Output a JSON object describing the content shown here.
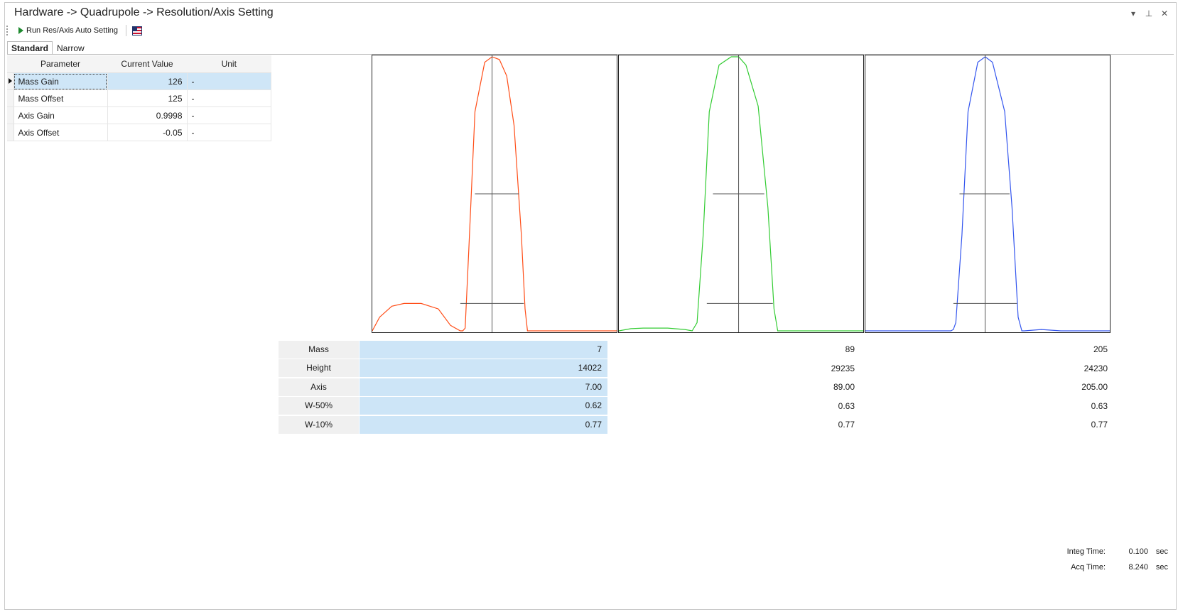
{
  "window": {
    "title": "Hardware -> Quadrupole -> Resolution/Axis Setting",
    "controls": {
      "dropdown": "▾",
      "pin": "⊥",
      "close": "✕"
    }
  },
  "toolbar": {
    "run_label": "Run Res/Axis Auto Setting"
  },
  "tabs": [
    {
      "label": "Standard",
      "active": true
    },
    {
      "label": "Narrow",
      "active": false
    }
  ],
  "param_table": {
    "headers": [
      "Parameter",
      "Current Value",
      "Unit"
    ],
    "rows": [
      {
        "name": "Mass Gain",
        "value": "126",
        "unit": "-"
      },
      {
        "name": "Mass Offset",
        "value": "125",
        "unit": "-"
      },
      {
        "name": "Axis Gain",
        "value": "0.9998",
        "unit": "-"
      },
      {
        "name": "Axis Offset",
        "value": "-0.05",
        "unit": "-"
      }
    ]
  },
  "chart_data": [
    {
      "type": "line",
      "color": "#ff4d17",
      "series": [
        {
          "x": [
            0,
            0.03,
            0.08,
            0.13,
            0.2,
            0.27,
            0.32,
            0.36,
            0.37,
            0.38,
            0.395,
            0.42,
            0.46,
            0.49,
            0.52,
            0.55,
            0.58,
            0.61,
            0.625,
            0.635,
            0.65,
            0.7,
            0.8,
            0.9,
            1.0
          ],
          "y": [
            0.0,
            0.05,
            0.09,
            0.1,
            0.1,
            0.08,
            0.02,
            0.0,
            0.0,
            0.01,
            0.3,
            0.8,
            0.98,
            1.0,
            0.99,
            0.93,
            0.75,
            0.35,
            0.08,
            0.0,
            0.0,
            0.0,
            0.0,
            0.0,
            0.0
          ]
        }
      ],
      "crosshair": {
        "center": 0.49,
        "half_max_level": 0.5,
        "half_max_bounds": [
          0.42,
          0.6
        ],
        "tenth_max_level": 0.1,
        "tenth_max_bounds": [
          0.36,
          0.62
        ]
      }
    },
    {
      "type": "line",
      "color": "#33cc33",
      "series": [
        {
          "x": [
            0,
            0.05,
            0.1,
            0.2,
            0.27,
            0.3,
            0.32,
            0.345,
            0.37,
            0.41,
            0.46,
            0.49,
            0.52,
            0.57,
            0.61,
            0.635,
            0.65,
            0.67,
            0.7,
            0.8,
            0.9,
            1.0
          ],
          "y": [
            0.0,
            0.008,
            0.01,
            0.01,
            0.005,
            0.0,
            0.03,
            0.35,
            0.8,
            0.97,
            1.0,
            1.0,
            0.97,
            0.82,
            0.45,
            0.08,
            0.0,
            0.0,
            0.0,
            0.0,
            0.0,
            0.0
          ]
        }
      ],
      "crosshair": {
        "center": 0.49,
        "half_max_level": 0.5,
        "half_max_bounds": [
          0.385,
          0.595
        ],
        "tenth_max_level": 0.1,
        "tenth_max_bounds": [
          0.36,
          0.63
        ]
      }
    },
    {
      "type": "line",
      "color": "#3355ee",
      "series": [
        {
          "x": [
            0,
            0.1,
            0.2,
            0.3,
            0.35,
            0.36,
            0.37,
            0.395,
            0.42,
            0.46,
            0.49,
            0.52,
            0.57,
            0.6,
            0.625,
            0.64,
            0.65,
            0.72,
            0.8,
            0.9,
            1.0
          ],
          "y": [
            0.0,
            0.0,
            0.0,
            0.0,
            0.0,
            0.005,
            0.03,
            0.35,
            0.8,
            0.98,
            1.0,
            0.98,
            0.8,
            0.45,
            0.05,
            0.0,
            0.0,
            0.005,
            0.0,
            0.0,
            0.0
          ]
        }
      ],
      "crosshair": {
        "center": 0.49,
        "half_max_level": 0.5,
        "half_max_bounds": [
          0.385,
          0.59
        ],
        "tenth_max_level": 0.1,
        "tenth_max_bounds": [
          0.36,
          0.62
        ]
      }
    }
  ],
  "results": {
    "rows": [
      {
        "label": "Mass",
        "values": [
          "7",
          "89",
          "205"
        ]
      },
      {
        "label": "Height",
        "values": [
          "14022",
          "29235",
          "24230"
        ]
      },
      {
        "label": "Axis",
        "values": [
          "7.00",
          "89.00",
          "205.00"
        ]
      },
      {
        "label": "W-50%",
        "values": [
          "0.62",
          "0.63",
          "0.63"
        ]
      },
      {
        "label": "W-10%",
        "values": [
          "0.77",
          "0.77",
          "0.77"
        ]
      }
    ]
  },
  "footer": {
    "integ_label": "Integ Time:",
    "integ_value": "0.100",
    "integ_unit": "sec",
    "acq_label": "Acq Time:",
    "acq_value": "8.240",
    "acq_unit": "sec"
  }
}
